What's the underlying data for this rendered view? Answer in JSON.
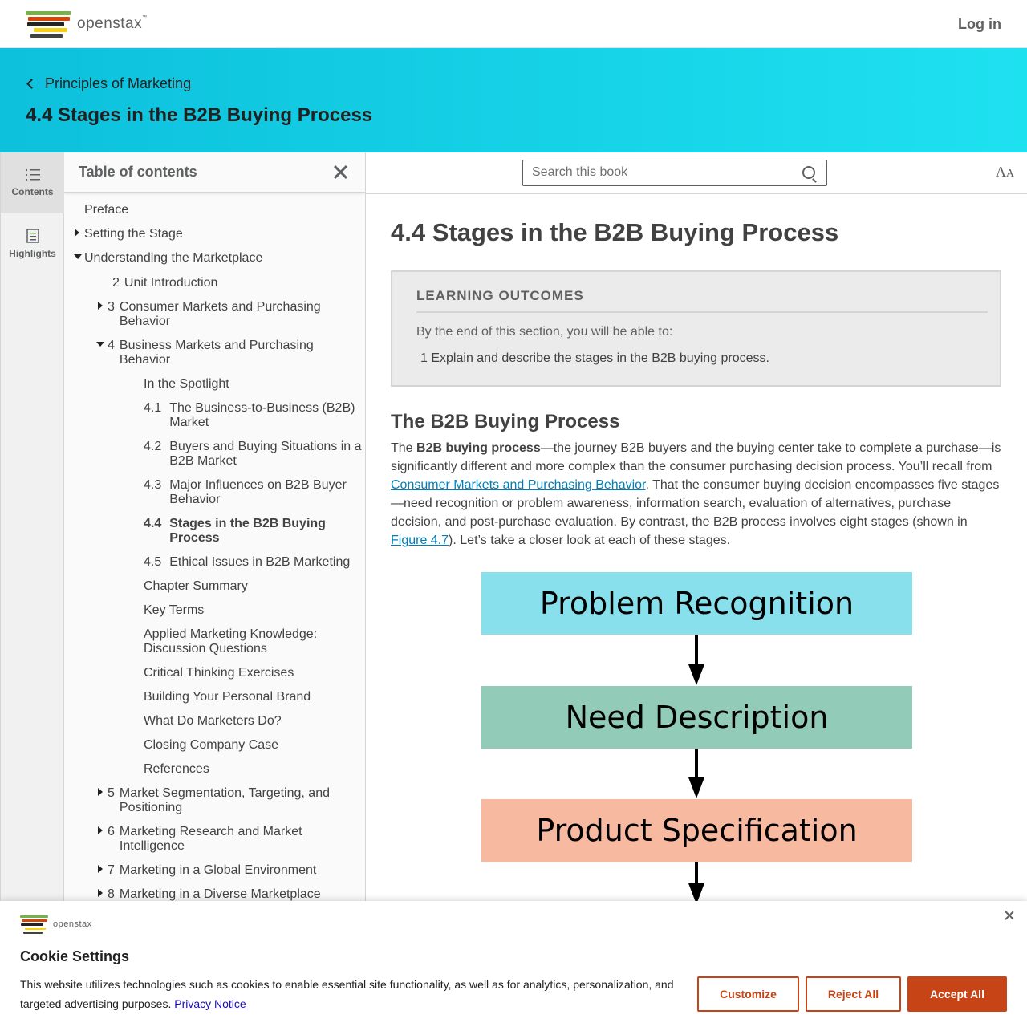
{
  "header": {
    "logo_text": "openstax",
    "logo_tm": "™",
    "login_label": "Log in",
    "logo_colors": [
      "#78b04a",
      "#d4450c",
      "#232323",
      "#f4d019",
      "#424242"
    ]
  },
  "hero": {
    "back_label": "Principles of Marketing",
    "title": "4.4 Stages in the B2B Buying Process",
    "gradient": [
      "#0dc0dc",
      "#1ee1f0"
    ]
  },
  "rail": {
    "contents_label": "Contents",
    "highlights_label": "Highlights"
  },
  "toc": {
    "title": "Table of contents",
    "items": [
      {
        "num": "",
        "label": "Preface"
      },
      {
        "num": "",
        "label": "Setting the Stage"
      },
      {
        "num": "",
        "label": "Understanding the Marketplace"
      },
      {
        "num": "2",
        "label": "Unit Introduction"
      },
      {
        "num": "3",
        "label": "Consumer Markets and Purchasing Behavior"
      },
      {
        "num": "4",
        "label": "Business Markets and Purchasing Behavior"
      },
      {
        "num": "",
        "label": "In the Spotlight"
      },
      {
        "num": "4.1",
        "label": "The Business-to-Business (B2B) Market"
      },
      {
        "num": "4.2",
        "label": "Buyers and Buying Situations in a B2B Market"
      },
      {
        "num": "4.3",
        "label": "Major Influences on B2B Buyer Behavior"
      },
      {
        "num": "4.4",
        "label": "Stages in the B2B Buying Process"
      },
      {
        "num": "4.5",
        "label": "Ethical Issues in B2B Marketing"
      },
      {
        "num": "",
        "label": "Chapter Summary"
      },
      {
        "num": "",
        "label": "Key Terms"
      },
      {
        "num": "",
        "label": "Applied Marketing Knowledge: Discussion Questions"
      },
      {
        "num": "",
        "label": "Critical Thinking Exercises"
      },
      {
        "num": "",
        "label": "Building Your Personal Brand"
      },
      {
        "num": "",
        "label": "What Do Marketers Do?"
      },
      {
        "num": "",
        "label": "Closing Company Case"
      },
      {
        "num": "",
        "label": "References"
      },
      {
        "num": "5",
        "label": "Market Segmentation, Targeting, and Positioning"
      },
      {
        "num": "6",
        "label": "Marketing Research and Market Intelligence"
      },
      {
        "num": "7",
        "label": "Marketing in a Global Environment"
      },
      {
        "num": "8",
        "label": "Marketing in a Diverse Marketplace"
      }
    ]
  },
  "search": {
    "placeholder": "Search this book",
    "font_icon_label": "AA"
  },
  "content": {
    "title": "4.4 Stages in the B2B Buying Process",
    "learning_outcomes": {
      "heading": "LEARNING OUTCOMES",
      "intro": "By the end of this section, you will be able to:",
      "items": [
        {
          "num": "1",
          "text": "Explain and describe the stages in the B2B buying process."
        }
      ]
    },
    "section_heading": "The B2B Buying Process",
    "para": {
      "p1": "The ",
      "term": "B2B buying process",
      "p2": "—the journey B2B buyers and the buying center take to complete a purchase—is significantly different and more complex than the consumer purchasing decision process. You’ll recall from ",
      "link1": "Consumer Markets and Purchasing Behavior",
      "p3": ". That the consumer buying decision encompasses five stages—need recognition or problem awareness, information search, evaluation of alternatives, purchase decision, and post-purchase evaluation. By contrast, the B2B process involves eight stages (shown in ",
      "link2": "Figure 4.7",
      "p4": "). Let’s take a closer look at each of these stages."
    },
    "figure": {
      "stages": [
        {
          "label": "Problem Recognition",
          "color": "#88e0ec"
        },
        {
          "label": "Need Description",
          "color": "#92ccb9"
        },
        {
          "label": "Product Specification",
          "color": "#f7b9a0"
        }
      ]
    }
  },
  "cookie": {
    "logo_text": "openstax",
    "title": "Cookie Settings",
    "text": "This website utilizes technologies such as cookies to enable essential site functionality, as well as for analytics, personalization, and targeted advertising purposes. ",
    "privacy_link": "Privacy Notice",
    "customize_label": "Customize",
    "reject_label": "Reject All",
    "accept_label": "Accept All",
    "accent": "#c64416"
  }
}
